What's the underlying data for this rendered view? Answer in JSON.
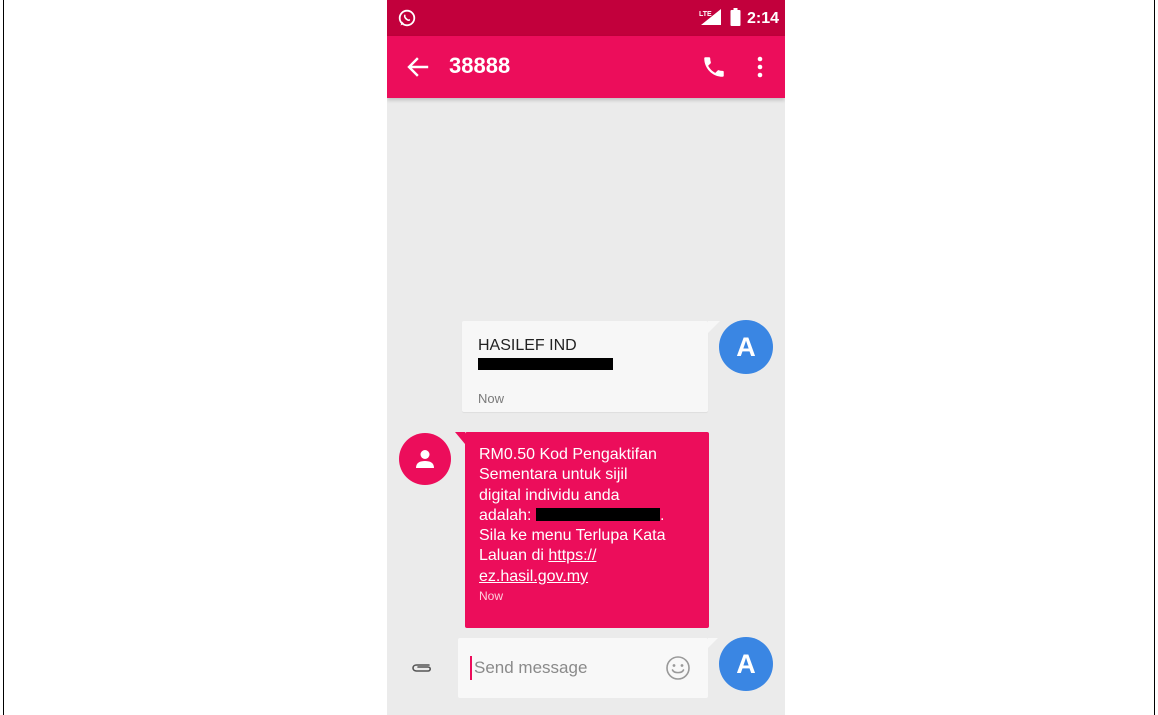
{
  "status_bar": {
    "network": "LTE",
    "time": "2:14"
  },
  "app_bar": {
    "title": "38888"
  },
  "messages": [
    {
      "direction": "outgoing",
      "text": "HASILEF IND",
      "time": "Now",
      "avatar_letter": "A"
    },
    {
      "direction": "incoming",
      "lines": [
        "RM0.50 Kod Pengaktifan",
        "Sementara untuk sijil",
        "digital individu anda",
        "adalah: "
      ],
      "after_redact": ".",
      "continued": [
        "Sila ke menu Terlupa Kata",
        "Laluan di "
      ],
      "link_part1": "https://",
      "link_part2": "ez.hasil.gov.my",
      "time": "Now"
    }
  ],
  "compose": {
    "placeholder": "Send message",
    "avatar_letter": "A"
  },
  "colors": {
    "status_bar": "#c2003c",
    "app_bar": "#ec0d5b",
    "avatar": "#3a86e3",
    "background": "#ebebeb"
  }
}
